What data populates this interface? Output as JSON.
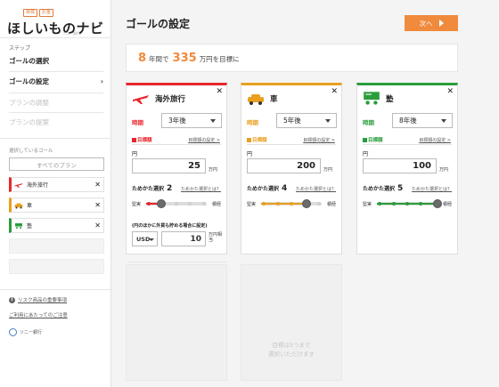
{
  "app": {
    "logo": {
      "text": "ほしいものナビ",
      "tag1": "目標",
      "tag2": "お金",
      "sub": "ソニー銀行"
    }
  },
  "sidebar": {
    "step_label": "ステップ",
    "steps": [
      {
        "label": "ゴールの選択"
      },
      {
        "label": "ゴールの設定"
      },
      {
        "label": "プランの調整"
      },
      {
        "label": "プランの提案"
      }
    ],
    "goals_label": "選択しているゴール",
    "all_plans": "すべてのプラン",
    "goals": [
      {
        "label": "海外旅行",
        "color": "#e8262c",
        "icon": "airplane-icon"
      },
      {
        "label": "車",
        "color": "#e8a020",
        "icon": "car-icon"
      },
      {
        "label": "塾",
        "color": "#2a9d3c",
        "icon": "study-icon"
      }
    ],
    "links": [
      {
        "label": "リスク商品の重要事項"
      },
      {
        "label": "ご利用にあたってのご注意"
      }
    ],
    "bank_logo": "ソニー銀行"
  },
  "header": {
    "title": "ゴールの設定",
    "next_label": "次へ"
  },
  "summary": {
    "years": "8",
    "years_suffix": "年間で",
    "amount": "335",
    "amount_suffix": "万円を目標に"
  },
  "cards": [
    {
      "title": "海外旅行",
      "color": "#e8262c",
      "icon": "airplane-icon",
      "timing_label": "時期",
      "timing_value": "3年後",
      "target_label": "目標額",
      "target_link": "目標額の設定 >",
      "yen_label": "円",
      "amount": "25",
      "unit": "万円",
      "method_label": "ためかた選択",
      "method_value": "2",
      "method_link": "ためかた選択とは？",
      "slider_left": "堅実",
      "slider_right": "積極",
      "slider_level": 2,
      "foreign_note": "(円のほかに外貨も貯める場合に設定)",
      "currency": "USD",
      "fx_amount": "10",
      "fx_unit": "万円相当"
    },
    {
      "title": "車",
      "color": "#e8a020",
      "icon": "car-icon",
      "timing_label": "時期",
      "timing_value": "5年後",
      "target_label": "目標額",
      "target_link": "目標額の設定 >",
      "yen_label": "円",
      "amount": "200",
      "unit": "万円",
      "method_label": "ためかた選択",
      "method_value": "4",
      "method_link": "ためかた選択とは？",
      "slider_left": "堅実",
      "slider_right": "積極",
      "slider_level": 4
    },
    {
      "title": "塾",
      "color": "#2a9d3c",
      "icon": "study-icon",
      "timing_label": "時期",
      "timing_value": "8年後",
      "target_label": "目標額",
      "target_link": "目標額の設定 >",
      "yen_label": "円",
      "amount": "100",
      "unit": "万円",
      "method_label": "ためかた選択",
      "method_value": "5",
      "method_link": "ためかた選択とは？",
      "slider_left": "堅実",
      "slider_right": "積極",
      "slider_level": 5
    }
  ],
  "placeholder": {
    "line1": "目標は5つまで",
    "line2": "選択いただけます"
  }
}
